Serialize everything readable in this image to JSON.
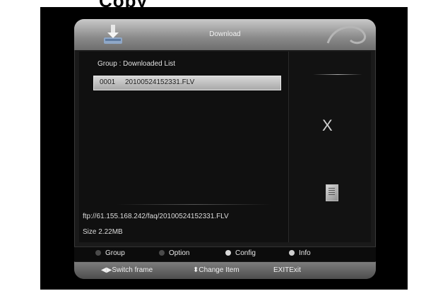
{
  "page_top_text": "Copy",
  "header": {
    "title": "Download"
  },
  "list": {
    "group_title": "Group : Downloaded List",
    "items": [
      {
        "index": "0001",
        "name": "20100524152331.FLV"
      }
    ]
  },
  "details": {
    "ftp_path": "ftp://61.155.168.242/faq/20100524152331.FLV",
    "size": "Size 2.22MB"
  },
  "side": {
    "close_glyph": "X",
    "icons": [
      "file-icon"
    ]
  },
  "buttons": [
    {
      "label": "Group",
      "dot_color": "#4a4a4a"
    },
    {
      "label": "Option",
      "dot_color": "#4a4a4a"
    },
    {
      "label": "Config",
      "dot_color": "#d8d8d8"
    },
    {
      "label": "Info",
      "dot_color": "#cfcfcf"
    }
  ],
  "navigation": {
    "switch_frame": "Switch frame",
    "change_item": "Change Item",
    "exit": "EXITExit"
  }
}
